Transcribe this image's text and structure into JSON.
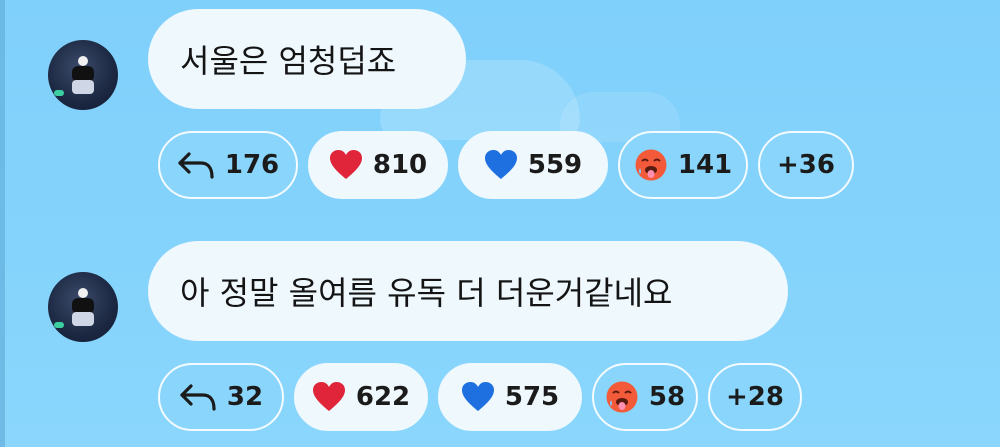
{
  "messages": [
    {
      "text": "서울은 엄청덥죠",
      "reactions": {
        "reply": "176",
        "heart": "810",
        "blue_heart": "559",
        "hot_face": "141",
        "more": "+36"
      }
    },
    {
      "text": "아 정말 올여름 유독 더 더운거같네요",
      "reactions": {
        "reply": "32",
        "heart": "622",
        "blue_heart": "575",
        "hot_face": "58",
        "more": "+28"
      }
    }
  ],
  "icons": {
    "reply": "reply-arrow-icon",
    "heart": "red-heart-icon",
    "blue_heart": "blue-heart-icon",
    "hot_face": "hot-face-icon"
  },
  "colors": {
    "background": "#84d3fc",
    "bubble": "#eef8fd",
    "heart_red": "#e0243a",
    "heart_blue": "#1e6fe0",
    "hot_face": "#f25a3a"
  }
}
